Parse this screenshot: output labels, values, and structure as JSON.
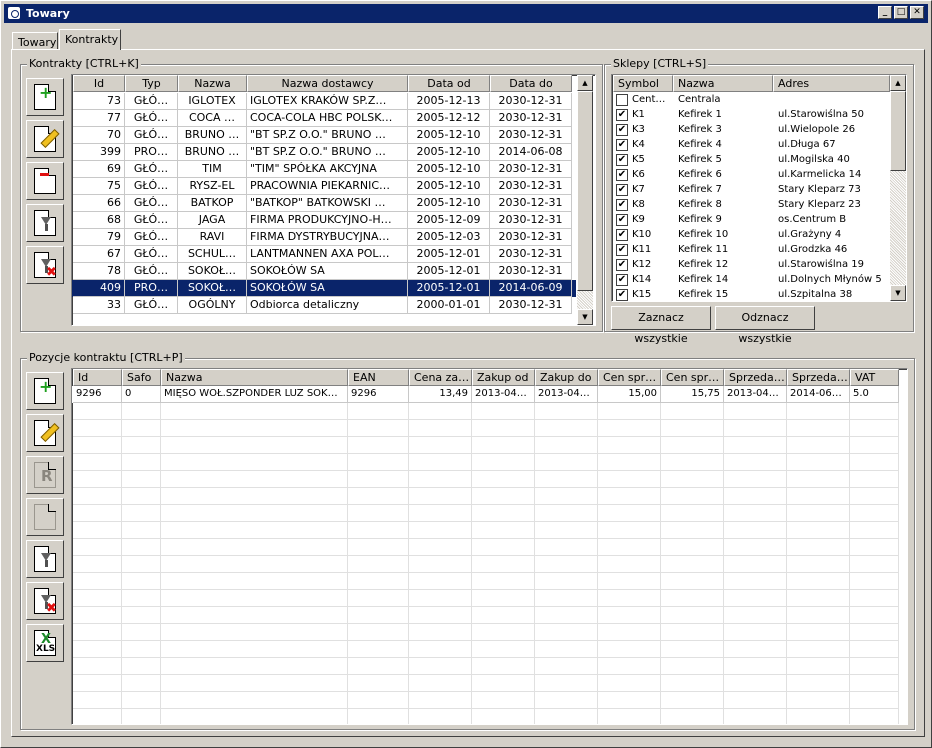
{
  "window": {
    "title": "Towary"
  },
  "tabs": [
    {
      "label": "Towary"
    },
    {
      "label": "Kontrakty"
    }
  ],
  "kontrakty": {
    "group_label": "Kontrakty [CTRL+K]",
    "columns": [
      "Id",
      "Typ",
      "Nazwa",
      "Nazwa dostawcy",
      "Data od",
      "Data do"
    ],
    "rows": [
      [
        "73",
        "GŁÓ…",
        "IGLOTEX",
        "IGLOTEX KRAKÓW SP.Z…",
        "2005-12-13",
        "2030-12-31"
      ],
      [
        "77",
        "GŁÓ…",
        "COCA …",
        "COCA-COLA HBC POLSK…",
        "2005-12-12",
        "2030-12-31"
      ],
      [
        "70",
        "GŁÓ…",
        "BRUNO …",
        "\"BT SP.Z O.O.\" BRUNO …",
        "2005-12-10",
        "2030-12-31"
      ],
      [
        "399",
        "PRO…",
        "BRUNO …",
        "\"BT SP.Z O.O.\" BRUNO …",
        "2005-12-10",
        "2014-06-08"
      ],
      [
        "69",
        "GŁÓ…",
        "TIM",
        "\"TIM\" SPÓŁKA AKCYJNA",
        "2005-12-10",
        "2030-12-31"
      ],
      [
        "75",
        "GŁÓ…",
        "RYSZ-EL",
        "PRACOWNIA PIEKARNIC…",
        "2005-12-10",
        "2030-12-31"
      ],
      [
        "66",
        "GŁÓ…",
        "BATKOP",
        "\"BATKOP\" BATKOWSKI …",
        "2005-12-10",
        "2030-12-31"
      ],
      [
        "68",
        "GŁÓ…",
        "JAGA",
        "FIRMA PRODUKCYJNO-H…",
        "2005-12-09",
        "2030-12-31"
      ],
      [
        "79",
        "GŁÓ…",
        "RAVI",
        "FIRMA DYSTRYBUCYJNA…",
        "2005-12-03",
        "2030-12-31"
      ],
      [
        "67",
        "GŁÓ…",
        "SCHUL…",
        "LANTMANNEN AXA POL…",
        "2005-12-01",
        "2030-12-31"
      ],
      [
        "78",
        "GŁÓ…",
        "SOKOŁ…",
        "SOKOŁÓW SA",
        "2005-12-01",
        "2030-12-31"
      ],
      [
        "409",
        "PRO…",
        "SOKOŁ…",
        "SOKOŁÓW SA",
        "2005-12-01",
        "2014-06-09"
      ],
      [
        "33",
        "GŁÓ…",
        "OGÓLNY",
        "Odbiorca detaliczny",
        "2000-01-01",
        "2030-12-31"
      ]
    ]
  },
  "sklepy": {
    "group_label": "Sklepy [CTRL+S]",
    "columns": [
      "Symbol",
      "Nazwa",
      "Adres"
    ],
    "rows": [
      {
        "checked": false,
        "symbol": "Cent…",
        "nazwa": "Centrala",
        "adres": ""
      },
      {
        "checked": true,
        "symbol": "K1",
        "nazwa": "Kefirek 1",
        "adres": "ul.Starowiślna 50"
      },
      {
        "checked": true,
        "symbol": "K3",
        "nazwa": "Kefirek 3",
        "adres": "ul.Wielopole 26"
      },
      {
        "checked": true,
        "symbol": "K4",
        "nazwa": "Kefirek 4",
        "adres": "ul.Długa 67"
      },
      {
        "checked": true,
        "symbol": "K5",
        "nazwa": "Kefirek 5",
        "adres": "ul.Mogilska 40"
      },
      {
        "checked": true,
        "symbol": "K6",
        "nazwa": "Kefirek 6",
        "adres": "ul.Karmelicka 14"
      },
      {
        "checked": true,
        "symbol": "K7",
        "nazwa": "Kefirek 7",
        "adres": "Stary Kleparz 73"
      },
      {
        "checked": true,
        "symbol": "K8",
        "nazwa": "Kefirek 8",
        "adres": "Stary Kleparz 23"
      },
      {
        "checked": true,
        "symbol": "K9",
        "nazwa": "Kefirek 9",
        "adres": "os.Centrum B"
      },
      {
        "checked": true,
        "symbol": "K10",
        "nazwa": "Kefirek 10",
        "adres": "ul.Grażyny 4"
      },
      {
        "checked": true,
        "symbol": "K11",
        "nazwa": "Kefirek 11",
        "adres": "ul.Grodzka 46"
      },
      {
        "checked": true,
        "symbol": "K12",
        "nazwa": "Kefirek 12",
        "adres": "ul.Starowiślna 19"
      },
      {
        "checked": true,
        "symbol": "K14",
        "nazwa": "Kefirek 14",
        "adres": "ul.Dolnych Młynów 5"
      },
      {
        "checked": true,
        "symbol": "K15",
        "nazwa": "Kefirek 15",
        "adres": "ul.Szpitalna 38"
      }
    ],
    "check_mark": "✔",
    "select_all_label": "Zaznacz wszystkie",
    "deselect_all_label": "Odznacz wszystkie"
  },
  "pozycje": {
    "group_label": "Pozycje kontraktu [CTRL+P]",
    "columns": [
      "Id",
      "Safo",
      "Nazwa",
      "EAN",
      "Cena za…",
      "Zakup od",
      "Zakup do",
      "Cen spr…",
      "Cen spr…",
      "Sprzeda…",
      "Sprzeda…",
      "VAT"
    ],
    "rows": [
      [
        "9296",
        "0",
        "MIĘSO WOŁ.SZPONDER LUZ SOK…",
        "9296",
        "13,49",
        "2013-04…",
        "2013-04…",
        "15,00",
        "15,75",
        "2013-04…",
        "2014-06…",
        "5.0"
      ]
    ]
  },
  "icons": {
    "plus": "+",
    "minus": "−",
    "close_x": "✖",
    "r_letter": "R",
    "xls_x": "X",
    "xls_text": "XLS",
    "scroll_up": "▲",
    "scroll_down": "▼",
    "win_minimize": "_",
    "win_maximize": "□",
    "win_close": "✕"
  },
  "selected_row_color": "#0a246a",
  "title_bar_color": "#0a246a"
}
